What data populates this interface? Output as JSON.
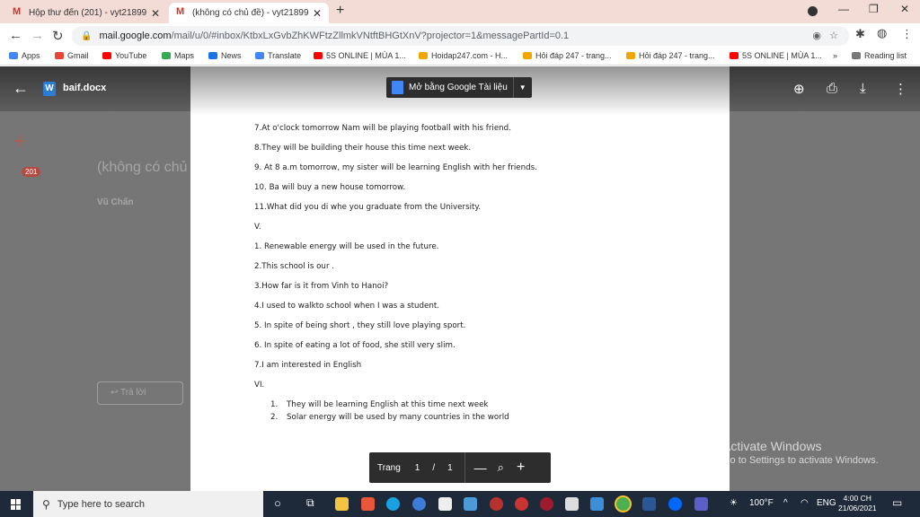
{
  "browser": {
    "tabs": [
      {
        "title": "Hộp thư đến (201) - vyt21899@g"
      },
      {
        "title": "(không có chủ đề) - vyt21899@g"
      }
    ],
    "url_main": "mail.google.com",
    "url_rest": "/mail/u/0/#inbox/KtbxLxGvbZhKWFtzZllmkVNtftBHGtXnV?projector=1&messagePartId=0.1",
    "bookmarks": [
      "Apps",
      "Gmail",
      "YouTube",
      "Maps",
      "News",
      "Translate",
      "5S ONLINE | MÙA 1...",
      "Hoidap247.com - H...",
      "Hỏi đáp 247 - trang...",
      "Hỏi đáp 247 - trang...",
      "5S ONLINE | MÙA 1..."
    ],
    "reading_list": "Reading list"
  },
  "viewer": {
    "file_name": "baif.docx",
    "open_with": "Mở bằng Google Tài liệu",
    "lines": [
      "7.At o'clock tomorrow Nam will be playing football with his friend.",
      "8.They will be building their house this time next week.",
      "9. At 8 a.m tomorrow, my sister will be learning English with her friends.",
      "10. Ba will buy a new house tomorrow.",
      "11.What did you di whe you graduate  from the University.",
      "V.",
      "1. Renewable energy will be used  in the future.",
      "2.This school is our .",
      "3.How far is it from Vinh to Hanoi?",
      "4.I used to walkto school when I was a student.",
      "5. In spite of being short , they still love playing sport.",
      "6. In spite of eating a lot of food, she still  very slim.",
      "7.I am interested in English",
      "VI."
    ],
    "sublines": [
      {
        "num": "1.",
        "text": "They will be learning English at this time  next week"
      },
      {
        "num": "2.",
        "text": "Solar energy will be used by many countries in the world"
      }
    ],
    "pager": {
      "label": "Trang",
      "current": "1",
      "sep": "/",
      "total": "1"
    }
  },
  "gmail_bg": {
    "unread_count": "201",
    "subject": "(không có chủ",
    "sender": "Vũ Chấn",
    "reply": "Trả lời"
  },
  "activate": {
    "title": "Activate Windows",
    "subtitle": "Go to Settings to activate Windows."
  },
  "taskbar": {
    "search_placeholder": "Type here to search",
    "temp": "100°F",
    "lang": "ENG",
    "time": "4:00 CH",
    "date": "21/06/2021"
  }
}
